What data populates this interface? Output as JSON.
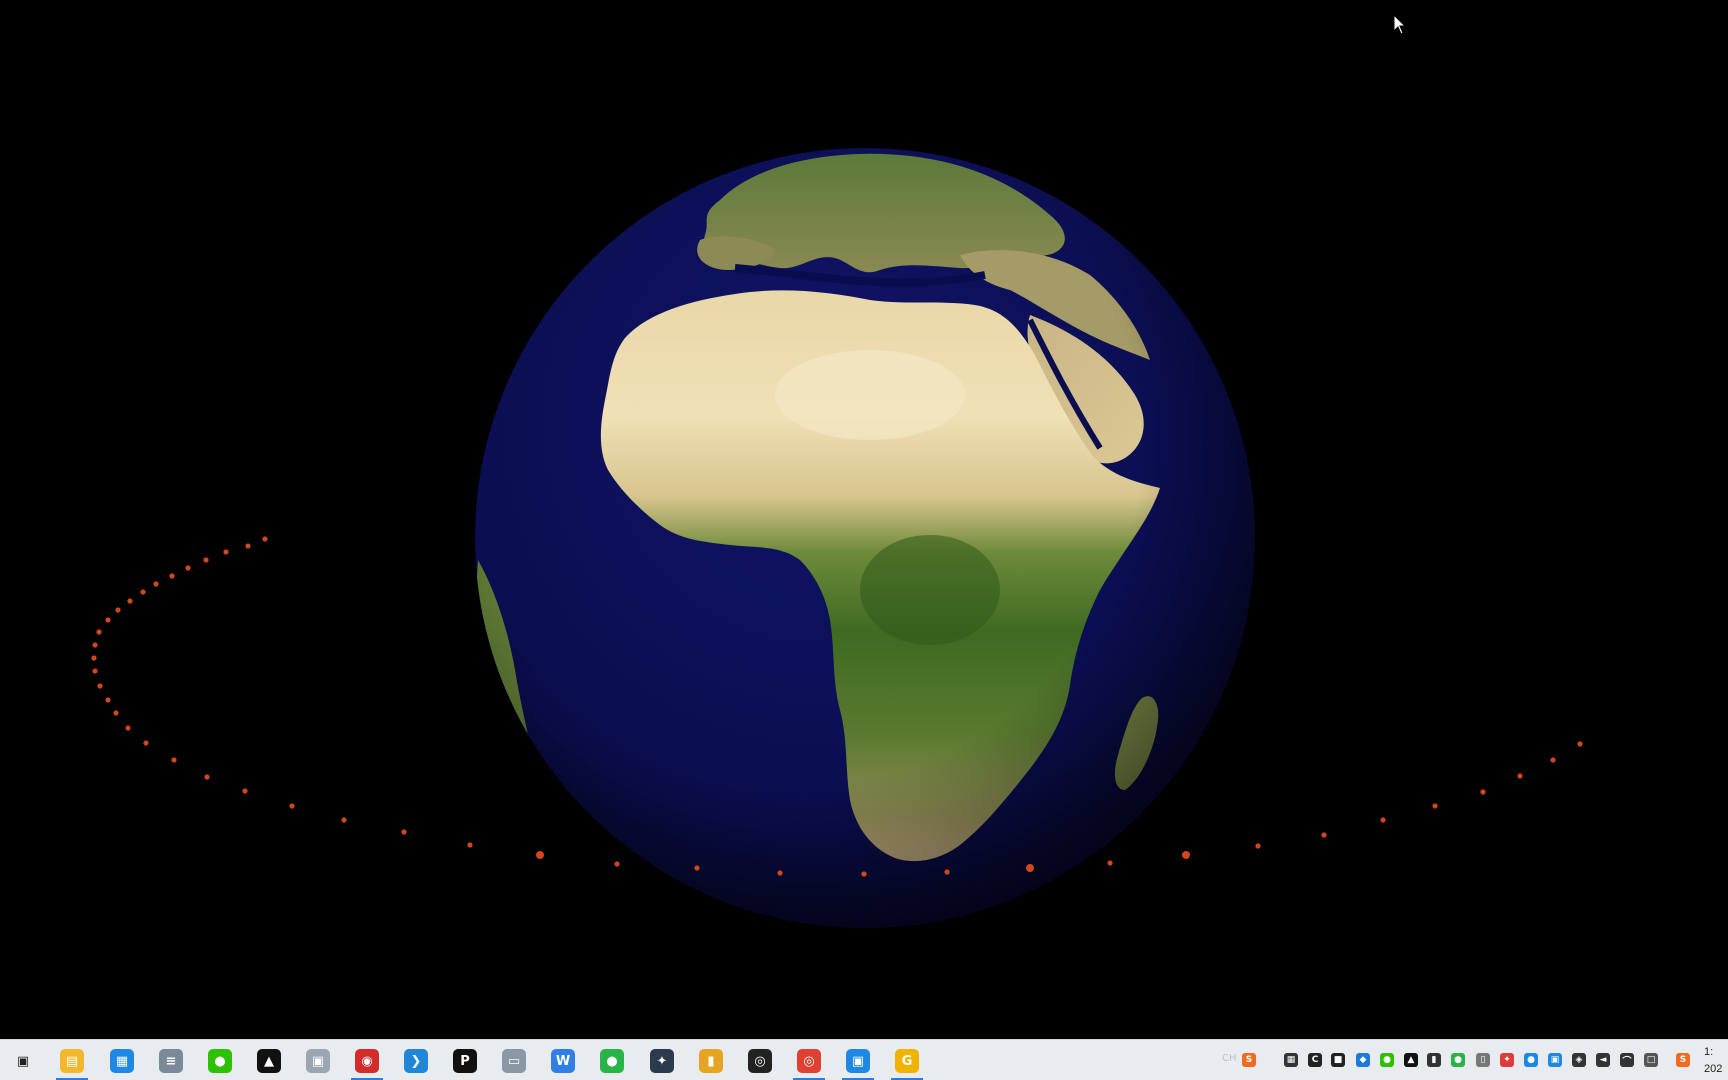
{
  "scene": {
    "subject": "rotating Earth globe with orbiting red dots"
  },
  "taskbar": {
    "apps": [
      {
        "name": "task-view",
        "icon": "task-view-icon",
        "color": "#222222",
        "running": false
      },
      {
        "name": "file-explorer",
        "icon": "folder-icon",
        "color": "#f2b72b",
        "running": true
      },
      {
        "name": "control-panel",
        "icon": "control-panel-icon",
        "color": "#1e88e5",
        "running": false
      },
      {
        "name": "calculator",
        "icon": "calculator-icon",
        "color": "#7b8a99",
        "running": false
      },
      {
        "name": "wechat",
        "icon": "wechat-icon",
        "color": "#2dc100",
        "running": false
      },
      {
        "name": "qq",
        "icon": "penguin-icon",
        "color": "#111111",
        "running": false
      },
      {
        "name": "photo-viewer",
        "icon": "photo-icon",
        "color": "#9aa6b2",
        "running": false
      },
      {
        "name": "screen-recorder",
        "icon": "record-icon",
        "color": "#d42b2b",
        "running": true
      },
      {
        "name": "vscode",
        "icon": "vscode-icon",
        "color": "#1f86d8",
        "running": false
      },
      {
        "name": "pixel-app",
        "icon": "circle-p-icon",
        "color": "#111111",
        "running": false
      },
      {
        "name": "remote-desktop",
        "icon": "monitor-icon",
        "color": "#8a97a5",
        "running": false
      },
      {
        "name": "wps-writer",
        "icon": "w-doc-icon",
        "color": "#2f7fe6",
        "running": false
      },
      {
        "name": "green-app",
        "icon": "green-circle-icon",
        "color": "#29b34b",
        "running": false
      },
      {
        "name": "davinci-resolve",
        "icon": "resolve-icon",
        "color": "#2b3a4d",
        "running": false
      },
      {
        "name": "office-tool",
        "icon": "bookmark-icon",
        "color": "#e5a422",
        "running": false
      },
      {
        "name": "obs",
        "icon": "obs-icon",
        "color": "#222222",
        "running": false
      },
      {
        "name": "chrome",
        "icon": "chrome-icon",
        "color": "#de4032",
        "running": true
      },
      {
        "name": "screenshot-tool",
        "icon": "capture-icon",
        "color": "#1e88e5",
        "running": true
      },
      {
        "name": "g-app",
        "icon": "g-icon",
        "color": "#f0b400",
        "running": true
      }
    ],
    "ime_label": "CH",
    "tray": [
      {
        "name": "sogou-input",
        "icon": "sogou-s-icon",
        "color": "#f06a22"
      },
      {
        "name": "tray-app-1",
        "icon": "grid-icon",
        "color": "#333333"
      },
      {
        "name": "tray-app-2",
        "icon": "coin-icon",
        "color": "#222222"
      },
      {
        "name": "tray-app-3",
        "icon": "flag-icon",
        "color": "#222222"
      },
      {
        "name": "tray-app-4",
        "icon": "cube-icon",
        "color": "#1e7ad8"
      },
      {
        "name": "tray-wechat",
        "icon": "wechat-icon",
        "color": "#2dc100"
      },
      {
        "name": "tray-qq",
        "icon": "penguin-icon",
        "color": "#111111"
      },
      {
        "name": "tray-mic",
        "icon": "microphone-icon",
        "color": "#333333"
      },
      {
        "name": "tray-app-5",
        "icon": "green-circle-icon",
        "color": "#29b34b"
      },
      {
        "name": "tray-usb",
        "icon": "usb-drive-icon",
        "color": "#777777"
      },
      {
        "name": "tray-app-6",
        "icon": "butterfly-icon",
        "color": "#e03a3a"
      },
      {
        "name": "tray-app-7",
        "icon": "blue-circle-icon",
        "color": "#1e88e5"
      },
      {
        "name": "tray-app-8",
        "icon": "screen-icon",
        "color": "#1e88e5"
      },
      {
        "name": "tray-security",
        "icon": "shield-icon",
        "color": "#333333"
      },
      {
        "name": "tray-volume",
        "icon": "speaker-icon",
        "color": "#333333"
      },
      {
        "name": "tray-wifi",
        "icon": "wifi-icon",
        "color": "#333333"
      },
      {
        "name": "tray-network",
        "icon": "network-icon",
        "color": "#555555"
      },
      {
        "name": "tray-sogou",
        "icon": "sogou-s-icon",
        "color": "#f06a22"
      }
    ],
    "clock": {
      "time": "1:",
      "date": "202"
    }
  }
}
